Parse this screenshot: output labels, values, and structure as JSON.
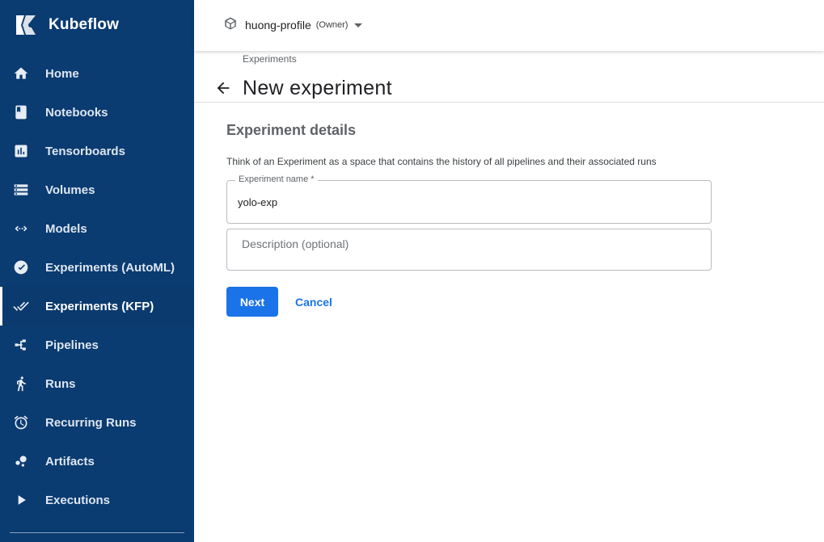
{
  "brand": {
    "name": "Kubeflow"
  },
  "sidebar": {
    "items": [
      {
        "label": "Home",
        "icon": "home-icon"
      },
      {
        "label": "Notebooks",
        "icon": "book-icon"
      },
      {
        "label": "Tensorboards",
        "icon": "assessment-icon"
      },
      {
        "label": "Volumes",
        "icon": "storage-icon"
      },
      {
        "label": "Models",
        "icon": "code-arrows-icon"
      },
      {
        "label": "Experiments (AutoML)",
        "icon": "speedometer-icon"
      },
      {
        "label": "Experiments (KFP)",
        "icon": "done-all-icon",
        "active": true
      },
      {
        "label": "Pipelines",
        "icon": "pipeline-icon"
      },
      {
        "label": "Runs",
        "icon": "directions-run-icon"
      },
      {
        "label": "Recurring Runs",
        "icon": "alarm-icon"
      },
      {
        "label": "Artifacts",
        "icon": "bubble-chart-icon"
      },
      {
        "label": "Executions",
        "icon": "play-arrow-icon"
      }
    ]
  },
  "topbar": {
    "namespace": "huong-profile",
    "role": "(Owner)"
  },
  "page": {
    "breadcrumb": "Experiments",
    "title": "New experiment"
  },
  "form": {
    "section_title": "Experiment details",
    "description": "Think of an Experiment as a space that contains the history of all pipelines and their associated runs",
    "name_label": "Experiment name *",
    "name_value": "yolo-exp",
    "description_placeholder": "Description (optional)",
    "next_label": "Next",
    "cancel_label": "Cancel"
  },
  "colors": {
    "sidebar_bg": "#0a3b71",
    "accent": "#1a73e8"
  }
}
